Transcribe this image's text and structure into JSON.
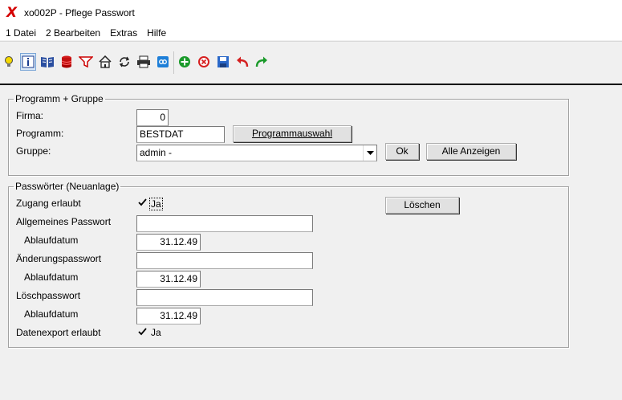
{
  "window": {
    "title": "xo002P - Pflege Passwort"
  },
  "menu": [
    "1 Datei",
    "2 Bearbeiten",
    "Extras",
    "Hilfe"
  ],
  "toolbar": {
    "icons": [
      "lightbulb-icon",
      "info-icon",
      "book-icon",
      "database-icon",
      "filter-icon",
      "home-icon",
      "refresh-icon",
      "print-icon",
      "link-icon",
      "add-icon",
      "delete-icon",
      "save-icon",
      "undo-icon",
      "redo-icon"
    ]
  },
  "group1": {
    "legend": "Programm + Gruppe",
    "firma_label": "Firma:",
    "firma_value": "0",
    "programm_label": "Programm:",
    "programm_value": "BESTDAT",
    "programmauswahl_button": "Programmauswahl",
    "gruppe_label": "Gruppe:",
    "gruppe_value": "admin -",
    "ok_button": "Ok",
    "alle_anzeigen_button": "Alle Anzeigen"
  },
  "group2": {
    "legend": "Passwörter (Neuanlage)",
    "zugang_label": "Zugang erlaubt",
    "zugang_checked": true,
    "zugang_check_label": "Ja",
    "loeschen_button": "Löschen",
    "allg_pw_label": "Allgemeines Passwort",
    "allg_pw_value": "",
    "ablauf1_label": "Ablaufdatum",
    "ablauf1_value": "31.12.49",
    "aend_pw_label": "Änderungspasswort",
    "aend_pw_value": "",
    "ablauf2_label": "Ablaufdatum",
    "ablauf2_value": "31.12.49",
    "loesch_pw_label": "Löschpasswort",
    "loesch_pw_value": "",
    "ablauf3_label": "Ablaufdatum",
    "ablauf3_value": "31.12.49",
    "export_label": "Datenexport erlaubt",
    "export_checked": true,
    "export_check_label": "Ja"
  }
}
